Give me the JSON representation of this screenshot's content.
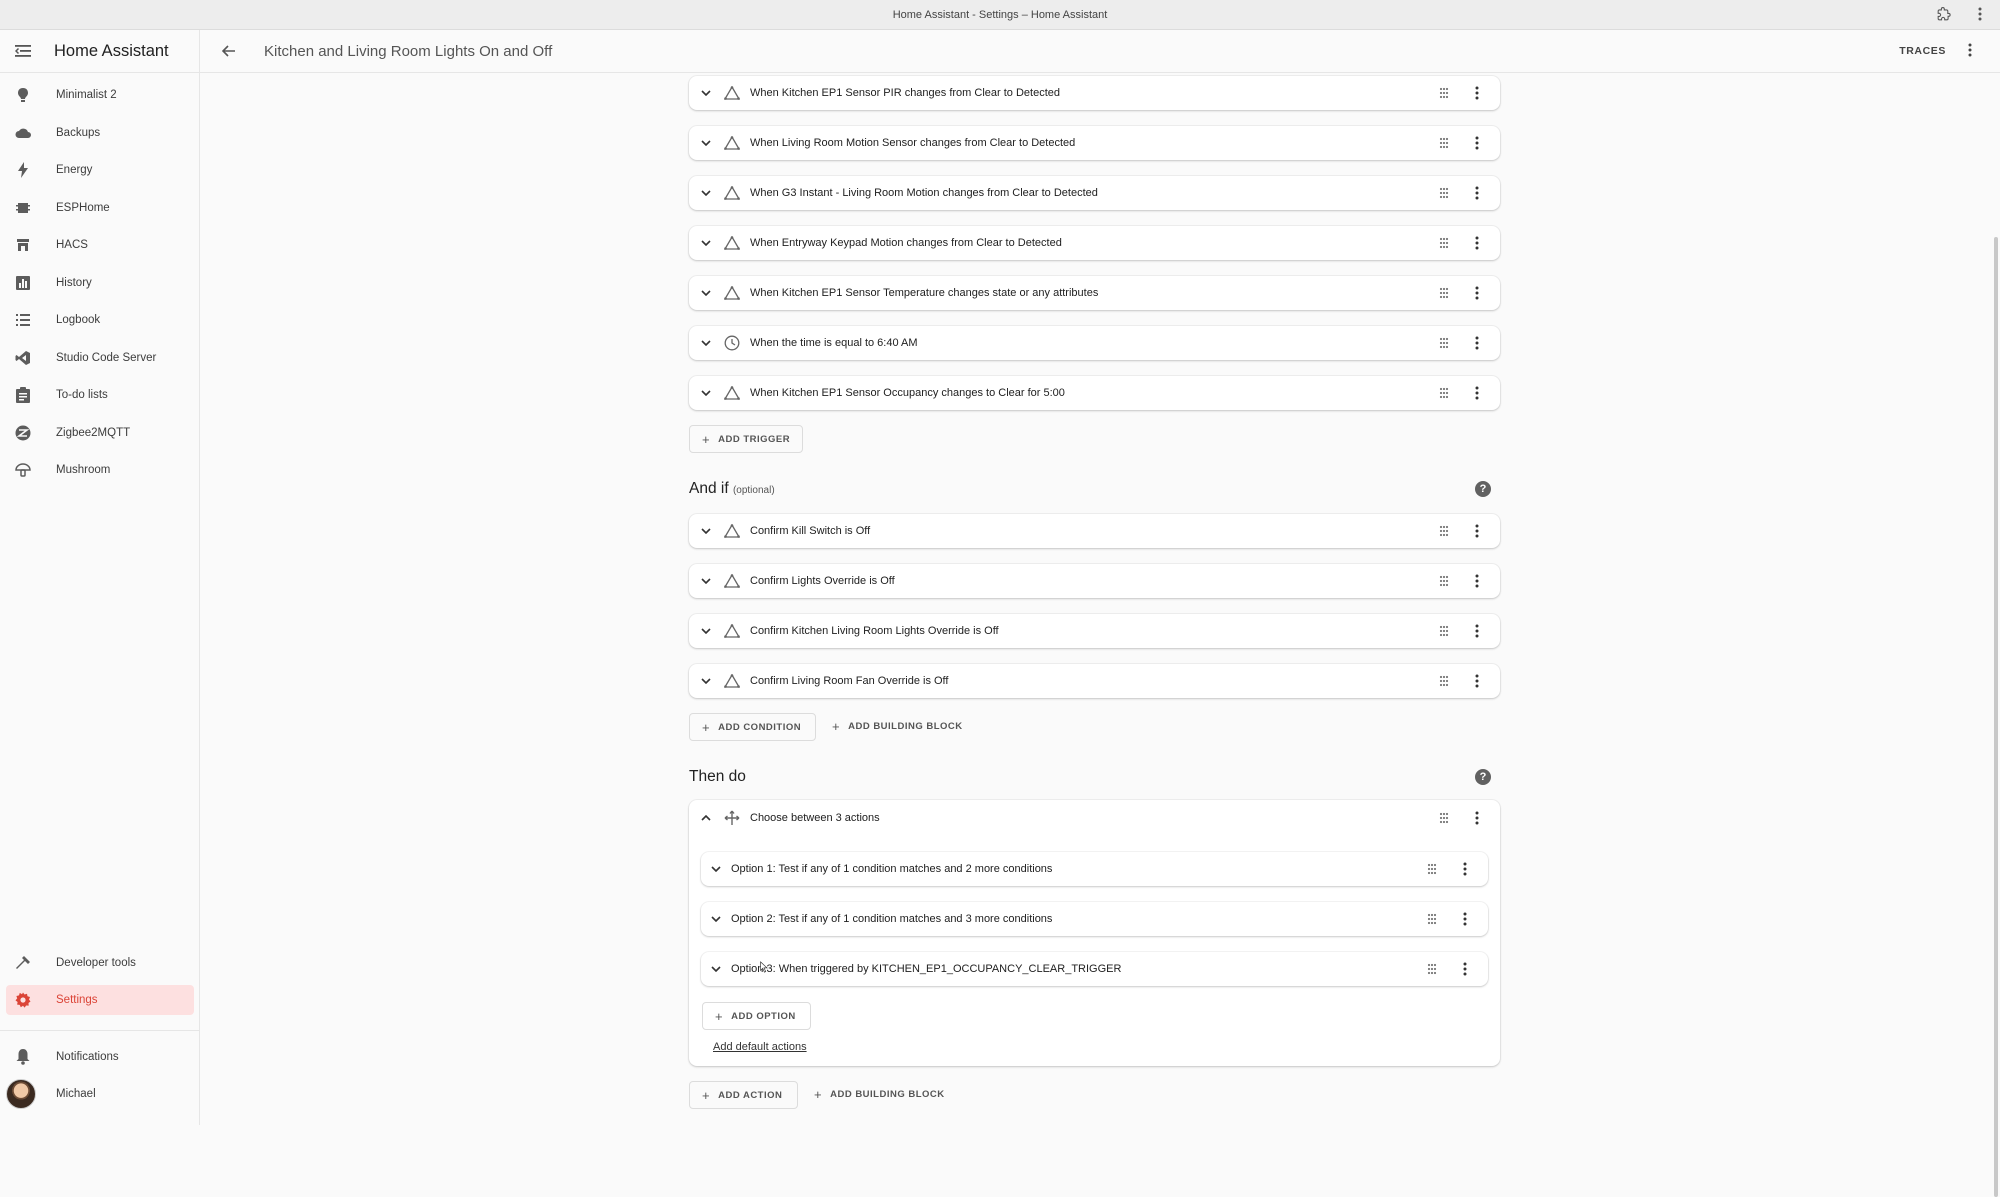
{
  "window": {
    "title": "Home Assistant - Settings – Home Assistant"
  },
  "sidebar": {
    "title": "Home Assistant",
    "items": [
      {
        "label": "Minimalist 2",
        "icon": "minimalist-icon"
      },
      {
        "label": "Backups",
        "icon": "cloud-icon"
      },
      {
        "label": "Energy",
        "icon": "lightning-icon"
      },
      {
        "label": "ESPHome",
        "icon": "chip-icon"
      },
      {
        "label": "HACS",
        "icon": "store-icon"
      },
      {
        "label": "History",
        "icon": "chart-icon"
      },
      {
        "label": "Logbook",
        "icon": "list-icon"
      },
      {
        "label": "Studio Code Server",
        "icon": "vscode-icon"
      },
      {
        "label": "To-do lists",
        "icon": "clipboard-icon"
      },
      {
        "label": "Zigbee2MQTT",
        "icon": "zigbee-icon"
      },
      {
        "label": "Mushroom",
        "icon": "mushroom-icon"
      }
    ],
    "bottom_items": [
      {
        "label": "Developer tools",
        "icon": "hammer-icon"
      },
      {
        "label": "Settings",
        "icon": "gear-icon",
        "active": true
      },
      {
        "label": "Notifications",
        "icon": "bell-icon"
      },
      {
        "label": "Michael",
        "icon": "avatar"
      }
    ],
    "active_color": "#db4437"
  },
  "header": {
    "title": "Kitchen and Living Room Lights On and Off",
    "traces_label": "TRACES"
  },
  "triggers": {
    "items": [
      "When Kitchen EP1 Sensor PIR changes from Clear to Detected",
      "When Living Room Motion Sensor changes from Clear to Detected",
      "When G3 Instant - Living Room Motion changes from Clear to Detected",
      "When Entryway Keypad Motion changes from Clear to Detected",
      "When Kitchen EP1 Sensor Temperature changes state or any attributes",
      "When the time is equal to 6:40 AM",
      "When Kitchen EP1 Sensor Occupancy changes to Clear for 5:00"
    ],
    "add_label": "ADD TRIGGER"
  },
  "conditions": {
    "title": "And if",
    "optional": "(optional)",
    "items": [
      "Confirm Kill Switch is Off",
      "Confirm Lights Override is Off",
      "Confirm Kitchen Living Room Lights Override is Off",
      "Confirm Living Room Fan Override is Off"
    ],
    "add_label": "ADD CONDITION",
    "add_block_label": "ADD BUILDING BLOCK"
  },
  "actions": {
    "title": "Then do",
    "choose_label": "Choose between 3 actions",
    "options": [
      "Option 1: Test if any of 1 condition matches and 2 more conditions",
      "Option 2: Test if any of 1 condition matches and 3 more conditions",
      "Option 3: When triggered by KITCHEN_EP1_OCCUPANCY_CLEAR_TRIGGER"
    ],
    "add_option_label": "ADD OPTION",
    "default_actions_label": "Add default actions",
    "add_action_label": "ADD ACTION",
    "add_block_label": "ADD BUILDING BLOCK"
  }
}
